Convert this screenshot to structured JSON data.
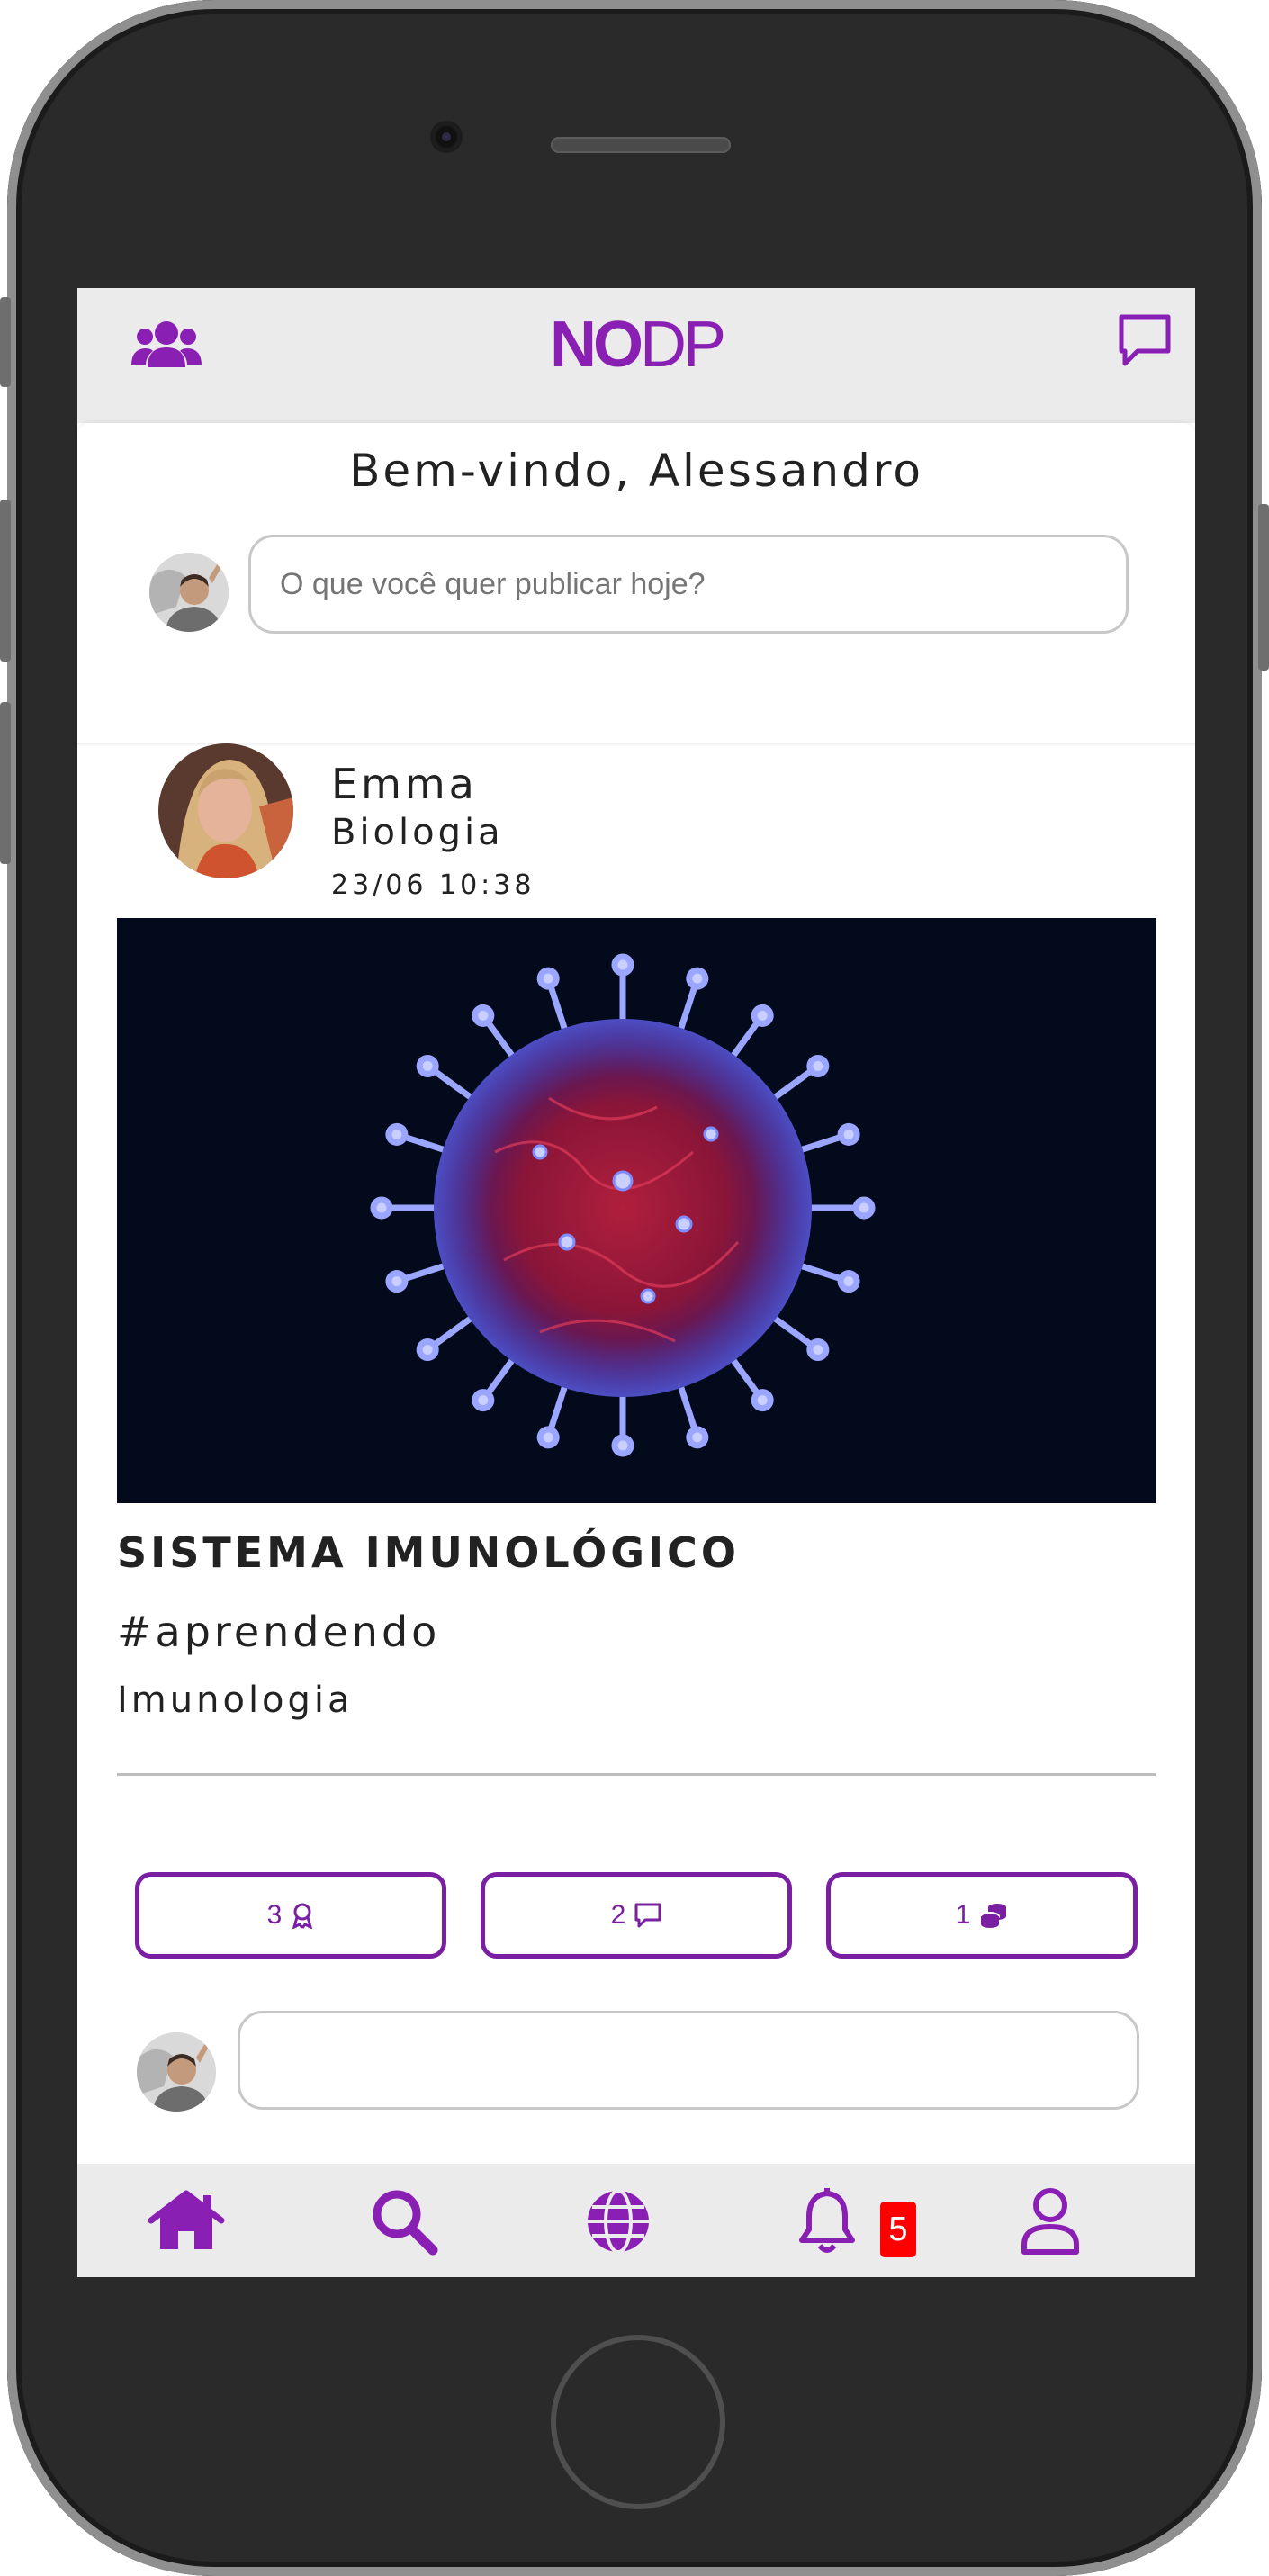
{
  "app": {
    "logo_bold": "NO",
    "logo_rest": "DP"
  },
  "header": {
    "left_icon": "users-icon",
    "right_icon": "chat-icon"
  },
  "welcome": {
    "text": "Bem-vindo, Alessandro"
  },
  "composer": {
    "placeholder": "O que você quer publicar hoje?"
  },
  "post": {
    "author": "Emma",
    "subject": "Biologia",
    "datetime": "23/06 10:38",
    "image": "virus-image",
    "title": "SISTEMA IMUNOLÓGICO",
    "hashtag": "#aprendendo",
    "category": "Imunologia",
    "actions": [
      {
        "count": "3",
        "icon": "award-icon"
      },
      {
        "count": "2",
        "icon": "comment-icon"
      },
      {
        "count": "1",
        "icon": "coins-icon"
      }
    ],
    "comment_placeholder": ""
  },
  "nav": {
    "items": [
      "home-icon",
      "search-icon",
      "globe-icon",
      "bell-icon",
      "user-icon"
    ],
    "notifications_badge": "5"
  },
  "colors": {
    "accent": "#8a1fb4",
    "badge": "#ff0000",
    "bar": "#ebebeb"
  }
}
